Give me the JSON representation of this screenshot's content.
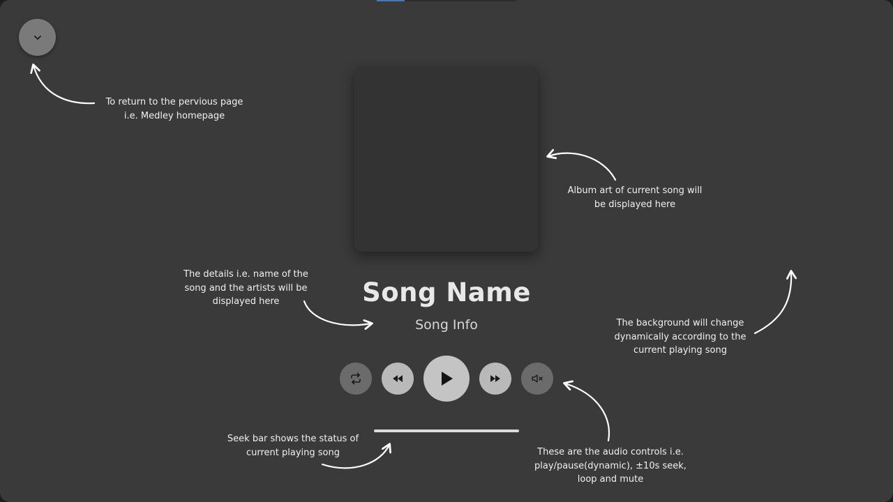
{
  "player": {
    "song_name": "Song Name",
    "song_info": "Song Info",
    "controls": {
      "loop_icon": "loop-icon",
      "rewind_icon": "rewind-icon",
      "play_icon": "play-icon",
      "forward_icon": "fast-forward-icon",
      "mute_icon": "mute-icon"
    },
    "back_icon": "chevron-down-icon"
  },
  "annotations": {
    "back": {
      "line1": "To return to the pervious page",
      "line2": "i.e. Medley homepage"
    },
    "album": {
      "line1": "Album art of current song will",
      "line2": "be displayed here"
    },
    "details": {
      "line1": "The details i.e. name of the",
      "line2": "song and the artists will be",
      "line3": "displayed here"
    },
    "background": {
      "line1": "The background will change",
      "line2": "dynamically according to the",
      "line3": "current playing song"
    },
    "seek": {
      "line1": "Seek bar shows the status of",
      "line2": "current playing song"
    },
    "controls": {
      "line1": "These are the audio controls i.e.",
      "line2": "play/pause(dynamic), ±10s seek,",
      "line3": "loop and mute"
    }
  },
  "colors": {
    "background": "#3a3a3a",
    "text": "#e8e8e8",
    "button_light": "#c4c4c4",
    "button_dark": "#6b6b6b"
  }
}
